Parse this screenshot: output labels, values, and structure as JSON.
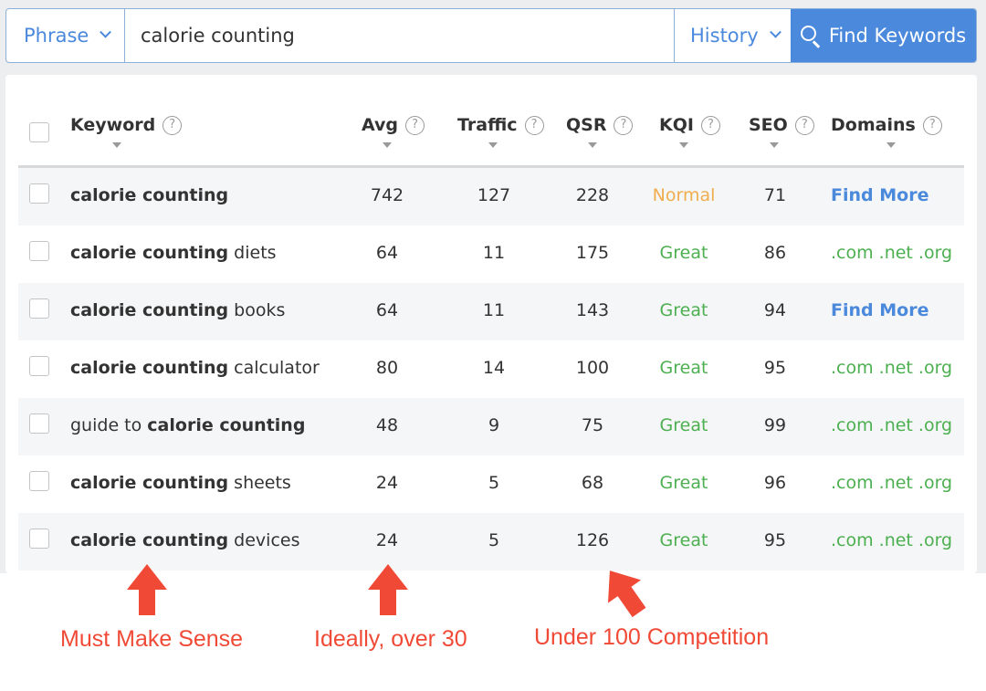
{
  "search": {
    "mode": "Phrase",
    "query": "calorie counting",
    "history_label": "History",
    "find_label": "Find Keywords"
  },
  "table": {
    "headers": {
      "keyword": "Keyword",
      "avg": "Avg",
      "traffic": "Traffic",
      "qsr": "QSR",
      "kqi": "KQI",
      "seo": "SEO",
      "domains": "Domains"
    },
    "rows": [
      {
        "pre": "",
        "bold": "calorie counting",
        "post": "",
        "avg": "742",
        "traffic": "127",
        "qsr": "228",
        "kqi": "Normal",
        "seo": "71",
        "domains": "Find More"
      },
      {
        "pre": "",
        "bold": "calorie counting",
        "post": " diets",
        "avg": "64",
        "traffic": "11",
        "qsr": "175",
        "kqi": "Great",
        "seo": "86",
        "domains": ".com .net .org"
      },
      {
        "pre": "",
        "bold": "calorie counting",
        "post": " books",
        "avg": "64",
        "traffic": "11",
        "qsr": "143",
        "kqi": "Great",
        "seo": "94",
        "domains": "Find More"
      },
      {
        "pre": "",
        "bold": "calorie counting",
        "post": " calculator",
        "avg": "80",
        "traffic": "14",
        "qsr": "100",
        "kqi": "Great",
        "seo": "95",
        "domains": ".com .net .org"
      },
      {
        "pre": "guide to ",
        "bold": "calorie counting",
        "post": "",
        "avg": "48",
        "traffic": "9",
        "qsr": "75",
        "kqi": "Great",
        "seo": "99",
        "domains": ".com .net .org"
      },
      {
        "pre": "",
        "bold": "calorie counting",
        "post": " sheets",
        "avg": "24",
        "traffic": "5",
        "qsr": "68",
        "kqi": "Great",
        "seo": "96",
        "domains": ".com .net .org"
      },
      {
        "pre": "",
        "bold": "calorie counting",
        "post": " devices",
        "avg": "24",
        "traffic": "5",
        "qsr": "126",
        "kqi": "Great",
        "seo": "95",
        "domains": ".com .net .org"
      }
    ]
  },
  "annotations": {
    "keyword": "Must Make Sense",
    "avg": "Ideally, over 30",
    "qsr": "Under 100 Competition"
  },
  "colors": {
    "accent": "#4a89dc",
    "great": "#4caf50",
    "normal": "#f0ad4e",
    "annotation": "#f04a36"
  }
}
